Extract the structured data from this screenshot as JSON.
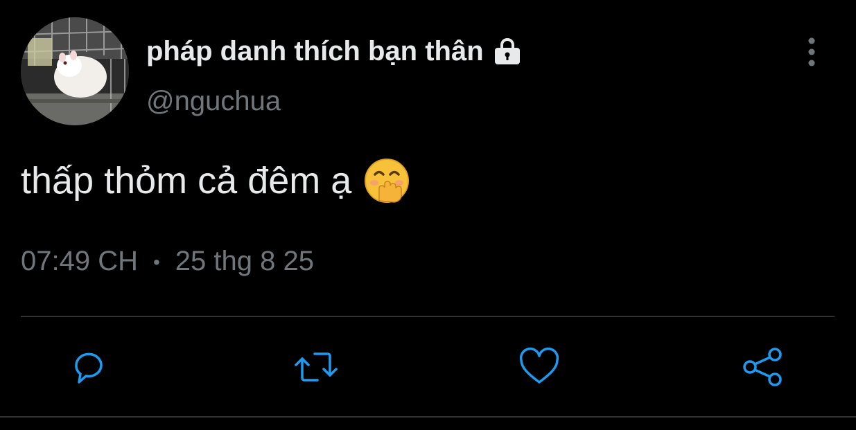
{
  "tweet": {
    "author": {
      "display_name": "pháp danh thích bạn thân",
      "handle": "@nguchua",
      "protected_icon": "lock-icon",
      "avatar": "hamster-in-cage-photo"
    },
    "text": "thấp thỏm cả đêm ạ",
    "emoji": "face-with-hand-over-mouth",
    "time": "07:49 CH",
    "date": "25 thg 8 25",
    "separator": "•"
  },
  "actions": [
    {
      "icon": "reply-icon"
    },
    {
      "icon": "retweet-icon"
    },
    {
      "icon": "like-icon"
    },
    {
      "icon": "share-icon"
    }
  ],
  "menu_icon": "more-vertical-icon",
  "colors": {
    "background": "#000000",
    "primary_text": "#e7e9ea",
    "secondary_text": "#71767b",
    "action_icon": "#1d9bf0",
    "divider": "#2f3336"
  }
}
